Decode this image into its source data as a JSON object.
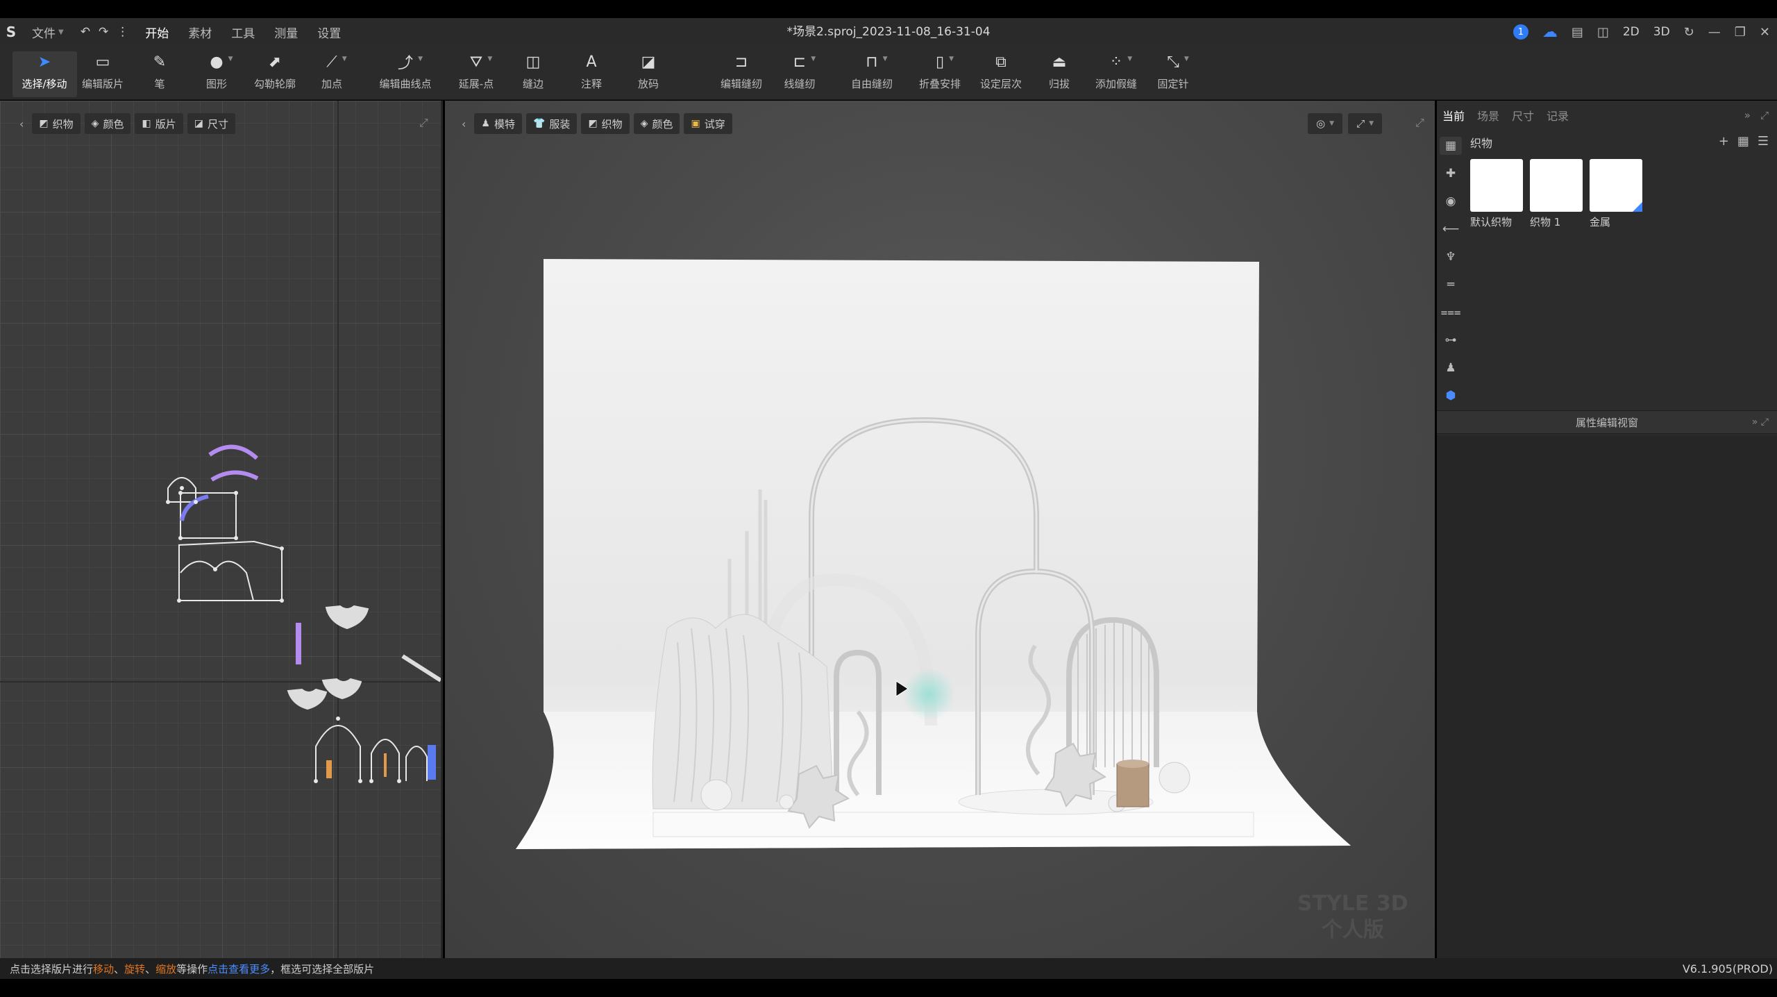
{
  "app": {
    "doc_title": "*场景2.sproj_2023-11-08_16-31-04",
    "menu": [
      {
        "label": "文件",
        "caret": true
      },
      {
        "label": "开始",
        "active": true
      },
      {
        "label": "素材"
      },
      {
        "label": "工具"
      },
      {
        "label": "测量"
      },
      {
        "label": "设置"
      }
    ],
    "notification_count": "1",
    "view_2d": "2D",
    "view_3d": "3D"
  },
  "toolbar": {
    "tools": [
      {
        "label": "选择/移动",
        "icon": "cursor-icon",
        "glyph": "➤",
        "active": true
      },
      {
        "label": "编辑版片",
        "icon": "edit-pattern-icon",
        "glyph": "▭"
      },
      {
        "label": "笔",
        "icon": "pen-icon",
        "glyph": "✎"
      },
      {
        "label": "图形",
        "icon": "shape-icon",
        "glyph": "●",
        "caret": true
      },
      {
        "label": "勾勒轮廓",
        "icon": "trace-outline-icon",
        "glyph": "⬈"
      },
      {
        "label": "加点",
        "icon": "add-point-icon",
        "glyph": "⟋",
        "caret": true
      },
      {
        "label": "编辑曲线点",
        "icon": "edit-curve-point-icon",
        "glyph": "⤴",
        "caret": true
      },
      {
        "label": "延展-点",
        "icon": "extend-point-icon",
        "glyph": "⛛",
        "caret": true
      },
      {
        "label": "缝边",
        "icon": "seam-allowance-icon",
        "glyph": "◫"
      },
      {
        "label": "注释",
        "icon": "annotation-icon",
        "glyph": "A"
      },
      {
        "label": "放码",
        "icon": "grading-icon",
        "glyph": "◪"
      },
      {
        "label": "编辑缝纫",
        "icon": "edit-sewing-icon",
        "glyph": "⊐"
      },
      {
        "label": "线缝纫",
        "icon": "line-sewing-icon",
        "glyph": "⊏",
        "caret": true
      },
      {
        "label": "自由缝纫",
        "icon": "free-sewing-icon",
        "glyph": "⊓",
        "caret": true
      },
      {
        "label": "折叠安排",
        "icon": "fold-arrange-icon",
        "glyph": "▯",
        "caret": true
      },
      {
        "label": "设定层次",
        "icon": "set-layer-icon",
        "glyph": "⧉"
      },
      {
        "label": "归拔",
        "icon": "shrink-stretch-icon",
        "glyph": "⏏"
      },
      {
        "label": "添加假缝",
        "icon": "add-tack-icon",
        "glyph": "⁘",
        "caret": true
      },
      {
        "label": "固定针",
        "icon": "pin-icon",
        "glyph": "⤡",
        "caret": true
      }
    ]
  },
  "pattern_view": {
    "chips": [
      {
        "label": "织物",
        "icon": "fabric-icon"
      },
      {
        "label": "颜色",
        "icon": "color-icon"
      },
      {
        "label": "版片",
        "icon": "pattern-icon"
      },
      {
        "label": "尺寸",
        "icon": "size-icon"
      }
    ]
  },
  "viewport": {
    "chips": [
      {
        "label": "模特",
        "icon": "avatar-icon"
      },
      {
        "label": "服装",
        "icon": "garment-icon"
      },
      {
        "label": "织物",
        "icon": "fabric-icon"
      },
      {
        "label": "颜色",
        "icon": "color-icon"
      },
      {
        "label": "试穿",
        "icon": "try-on-icon"
      }
    ],
    "watermark_line1": "STYLE 3D",
    "watermark_line2": "个人版"
  },
  "right_panel": {
    "tabs": [
      {
        "label": "当前",
        "active": true
      },
      {
        "label": "场景"
      },
      {
        "label": "尺寸"
      },
      {
        "label": "记录"
      }
    ],
    "section_title": "织物",
    "fabrics": [
      {
        "label": "默认织物"
      },
      {
        "label": "织物 1"
      },
      {
        "label": "金属",
        "selected": true
      }
    ],
    "property_editor_title": "属性编辑视窗"
  },
  "status": {
    "text_prefix": "点击选择版片进行",
    "op1": "移动",
    "op2": "旋转",
    "op3": "缩放",
    "text_mid": "等操作",
    "link": "点击查看更多",
    "text_suffix": "，框选可选择全部版片",
    "version": "V6.1.905(PROD)"
  }
}
